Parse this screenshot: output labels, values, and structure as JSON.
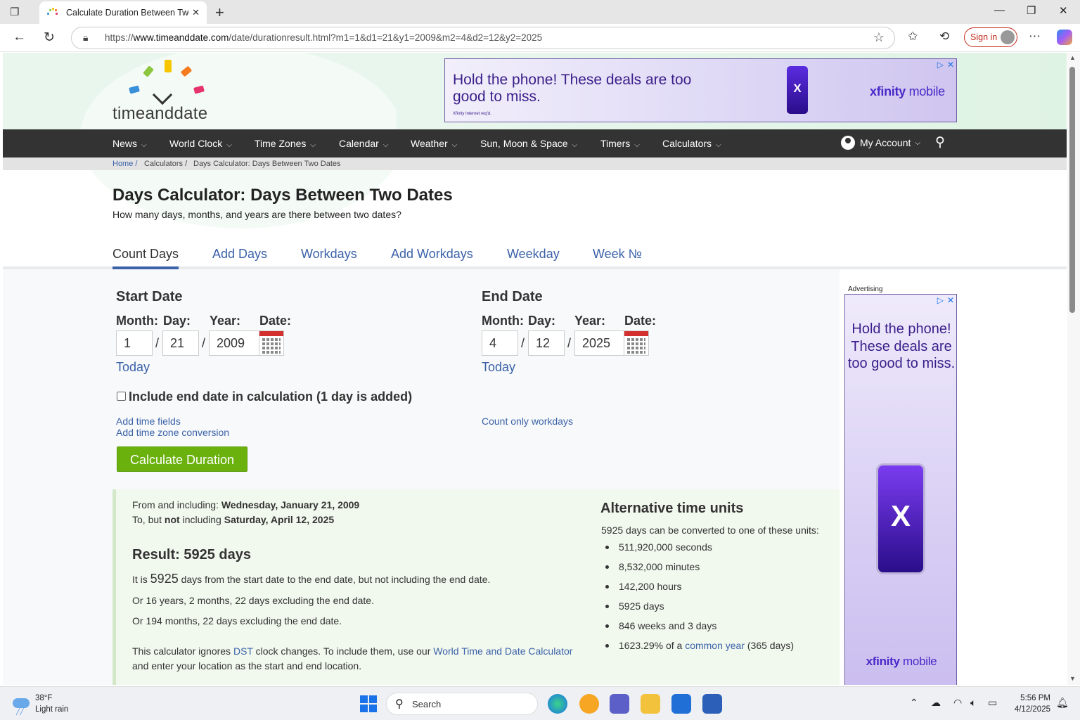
{
  "browser": {
    "tab_title": "Calculate Duration Between Two D",
    "url_prefix": "https://",
    "url_domain": "www.timeanddate.com",
    "url_path": "/date/durationresult.html?m1=1&d1=21&y1=2009&m2=4&d2=12&y2=2025",
    "sign_in": "Sign in"
  },
  "site": {
    "logo_text": "timeanddate",
    "nav": [
      "News",
      "World Clock",
      "Time Zones",
      "Calendar",
      "Weather",
      "Sun, Moon & Space",
      "Timers",
      "Calculators"
    ],
    "account": "My Account",
    "breadcrumb": [
      "Home /",
      "Calculators /",
      "Days Calculator: Days Between Two Dates"
    ]
  },
  "ads": {
    "banner_text": "Hold the phone! These deals are too good to miss.",
    "banner_small": "Xfinity Internet req'd.",
    "brand_bold": "xfinity",
    "brand_rest": " mobile",
    "side_label": "Advertising",
    "side_text": "Hold the phone! These deals are too good to miss."
  },
  "page": {
    "title": "Days Calculator: Days Between Two Dates",
    "subtitle": "How many days, months, and years are there between two dates?",
    "tabs": [
      "Count Days",
      "Add Days",
      "Workdays",
      "Add Workdays",
      "Weekday",
      "Week №"
    ]
  },
  "form": {
    "start": {
      "heading": "Start Date",
      "month": "1",
      "day": "21",
      "year": "2009"
    },
    "end": {
      "heading": "End Date",
      "month": "4",
      "day": "12",
      "year": "2025"
    },
    "labels": {
      "month": "Month:",
      "day": "Day:",
      "year": "Year:",
      "date": "Date:",
      "today": "Today",
      "slash": "/"
    },
    "include_end": "Include end date in calculation (1 day is added)",
    "add_time_fields": "Add time fields",
    "add_tz": "Add time zone conversion",
    "count_workdays": "Count only workdays",
    "calculate": "Calculate Duration"
  },
  "result": {
    "from_pre": "From and including: ",
    "from_date": "Wednesday, January 21, 2009",
    "to_pre": "To, but ",
    "to_not": "not",
    "to_mid": " including ",
    "to_date": "Saturday, April 12, 2025",
    "heading": "Result: 5925 days",
    "line1_pre": "It is ",
    "line1_num": "5925",
    "line1_post": " days from the start date to the end date, but not including the end date.",
    "line2": "Or 16 years, 2 months, 22 days excluding the end date.",
    "line3": "Or 194 months, 22 days excluding the end date.",
    "note_pre": "This calculator ignores ",
    "note_dst": "DST",
    "note_mid": " clock changes. To include them, use our ",
    "note_link": "World Time and Date Calculator",
    "note_post": "and enter your location as the start and end location.",
    "alt_heading": "Alternative time units",
    "alt_intro": "5925 days can be converted to one of these units:",
    "alt_units": [
      "511,920,000 seconds",
      "8,532,000 minutes",
      "142,200 hours",
      "5925 days",
      "846 weeks and 3 days"
    ],
    "alt_last_pre": "1623.29% of a ",
    "alt_last_link": "common year",
    "alt_last_post": " (365 days)"
  },
  "taskbar": {
    "temp": "38°F",
    "weather": "Light rain",
    "search": "Search",
    "time": "5:56 PM",
    "date": "4/12/2025"
  }
}
